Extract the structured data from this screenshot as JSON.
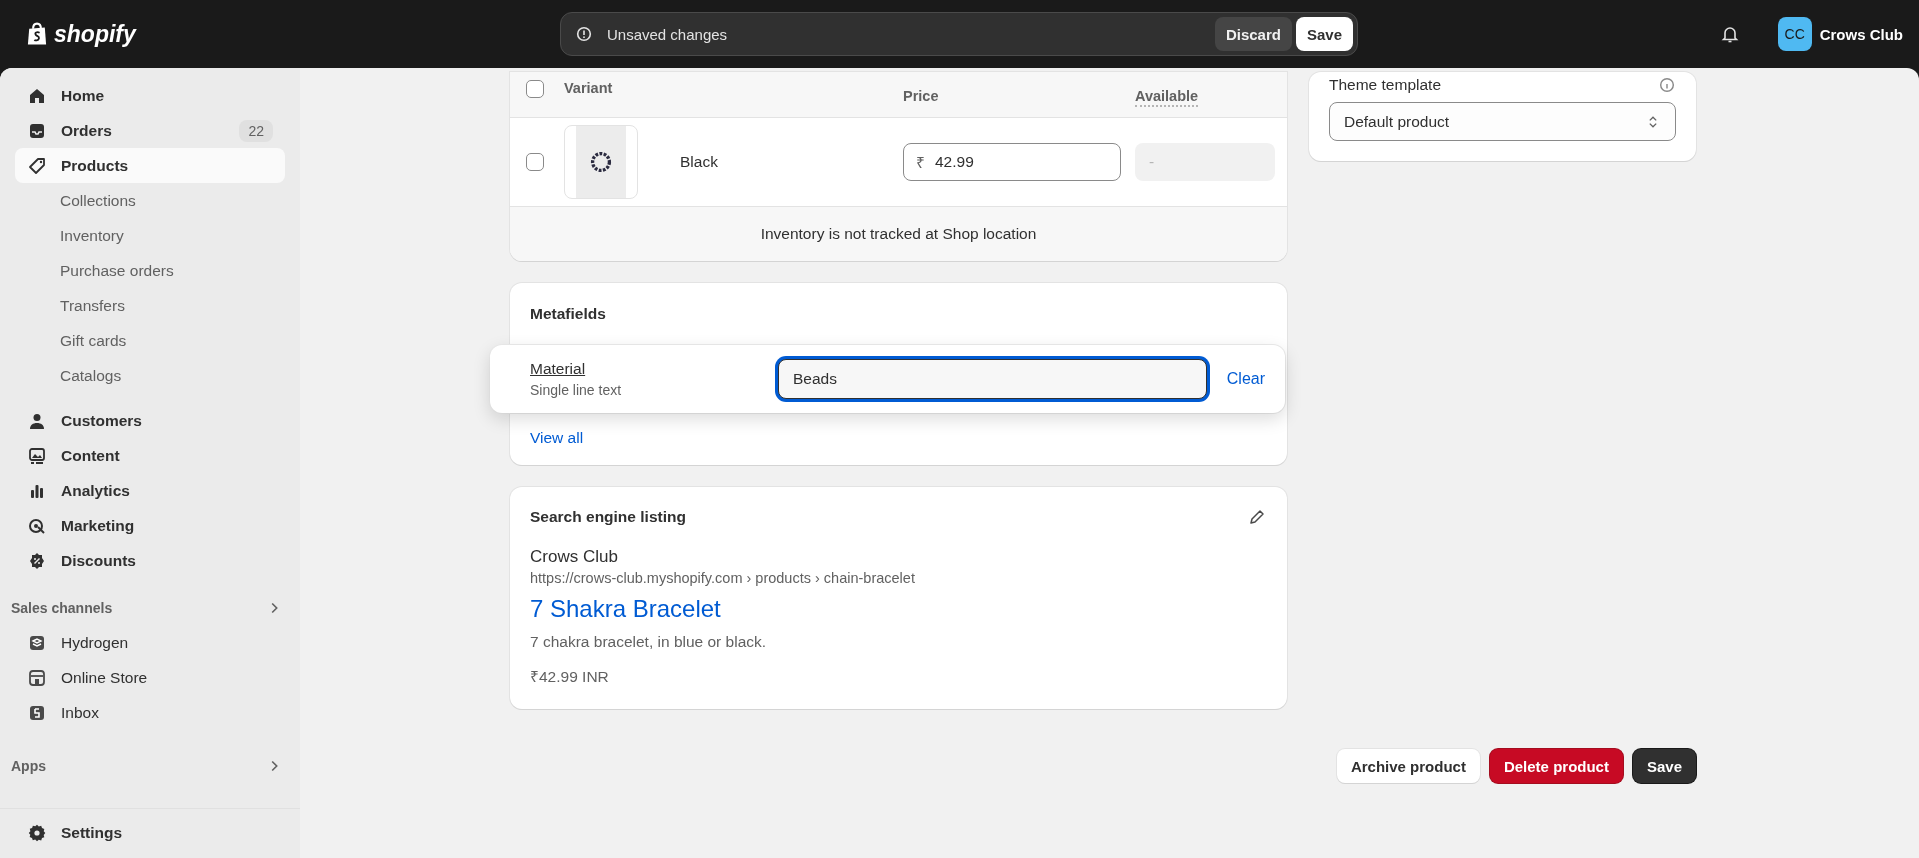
{
  "topbar": {
    "logo": "shopify",
    "notice": "Unsaved changes",
    "discard": "Discard",
    "save": "Save",
    "store": {
      "initials": "CC",
      "name": "Crows Club"
    }
  },
  "sidebar": {
    "items": [
      {
        "label": "Home",
        "selected": false
      },
      {
        "label": "Orders",
        "selected": false,
        "badge": "22"
      },
      {
        "label": "Products",
        "selected": true,
        "children": [
          {
            "label": "Collections",
            "selected": false
          },
          {
            "label": "Inventory",
            "selected": false
          },
          {
            "label": "Purchase orders",
            "selected": false
          },
          {
            "label": "Transfers",
            "selected": false
          },
          {
            "label": "Gift cards",
            "selected": false
          },
          {
            "label": "Catalogs",
            "selected": false
          }
        ]
      },
      {
        "label": "Customers",
        "selected": false
      },
      {
        "label": "Content",
        "selected": false
      },
      {
        "label": "Analytics",
        "selected": false
      },
      {
        "label": "Marketing",
        "selected": false
      },
      {
        "label": "Discounts",
        "selected": false
      }
    ],
    "sales_channels": {
      "title": "Sales channels",
      "items": [
        {
          "label": "Hydrogen",
          "selected": false
        },
        {
          "label": "Online Store",
          "selected": false
        },
        {
          "label": "Inbox",
          "selected": false
        }
      ]
    },
    "apps": {
      "title": "Apps"
    },
    "settings": {
      "label": "Settings"
    }
  },
  "variants": {
    "columns": [
      "Variant",
      "Price",
      "Available"
    ],
    "all_checked": false,
    "rows": [
      {
        "name": "Black",
        "checked": false,
        "currency": "₹",
        "price": "42.99",
        "available": "-"
      }
    ],
    "footer": "Inventory is not tracked at Shop location"
  },
  "metafields": {
    "title": "Metafields",
    "fields": [
      {
        "name": "Material",
        "type": "Single line text",
        "value": "Beads",
        "focused": true
      }
    ],
    "clear": "Clear",
    "view_all": "View all"
  },
  "seo": {
    "title": "Search engine listing",
    "store": "Crows Club",
    "url": "https://crows-club.myshopify.com › products › chain-bracelet",
    "page_title": "7 Shakra Bracelet",
    "description": "7 chakra bracelet, in blue or black.",
    "price": "₹42.99 INR"
  },
  "theme": {
    "label": "Theme template",
    "value": "Default product"
  },
  "actions": [
    {
      "label": "Archive product",
      "kind": "default"
    },
    {
      "label": "Delete product",
      "kind": "critical"
    },
    {
      "label": "Save",
      "kind": "primary"
    }
  ]
}
